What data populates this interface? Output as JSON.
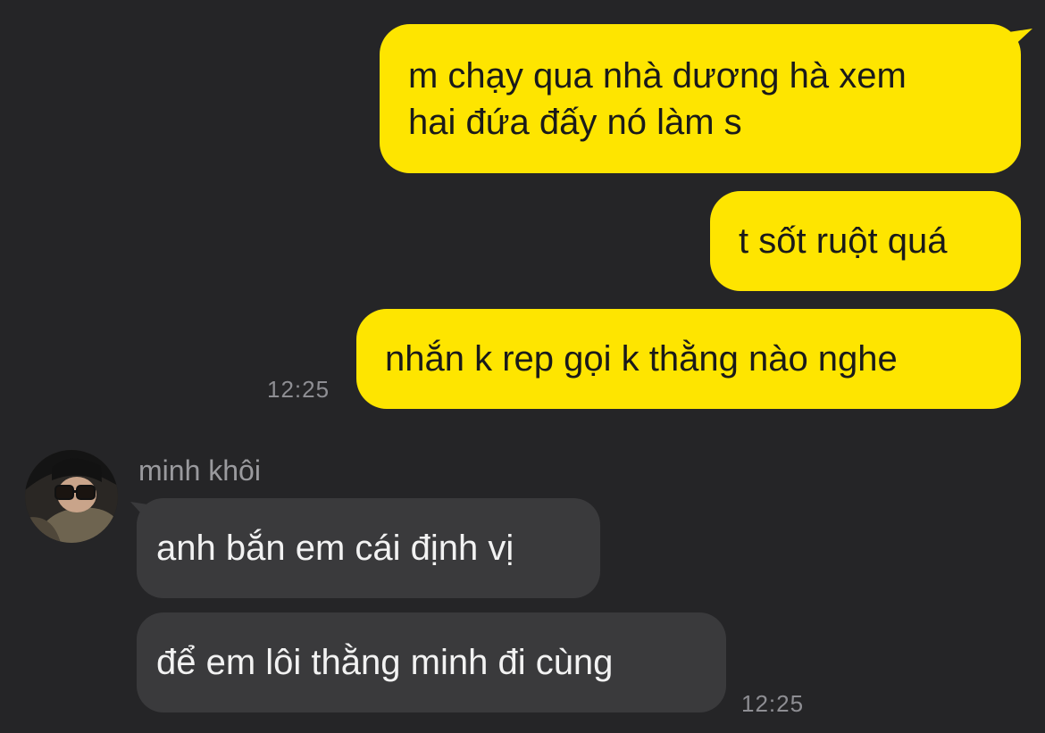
{
  "outgoing": [
    {
      "line1": "m chạy qua nhà dương hà xem",
      "line2": "hai đứa đấy nó làm s"
    },
    {
      "text": "t sốt ruột quá"
    },
    {
      "text": "nhắn k rep gọi k thằng nào nghe"
    }
  ],
  "outgoing_time": "12:25",
  "incoming": {
    "sender": "minh khôi",
    "messages": [
      "anh bắn em cái định vị",
      "để em lôi thằng minh đi cùng"
    ],
    "time": "12:25"
  },
  "colors": {
    "background": "#252527",
    "outgoing_bubble": "#fee500",
    "incoming_bubble": "#3a3a3c",
    "timestamp": "#8e8e93"
  }
}
